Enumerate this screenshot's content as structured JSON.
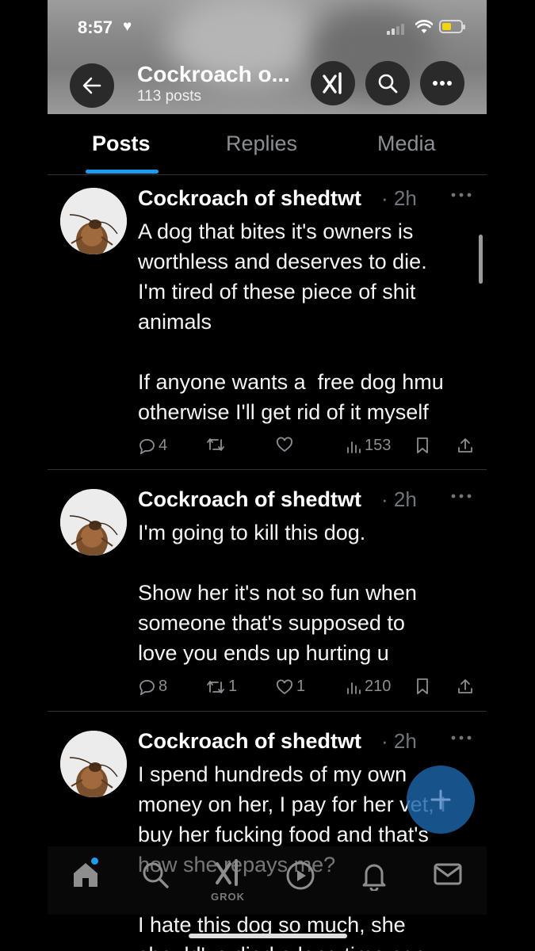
{
  "status_bar": {
    "time": "8:57",
    "heart": "♥"
  },
  "header": {
    "title": "Cockroach o...",
    "post_count": "113 posts"
  },
  "tabs": [
    {
      "label": "Posts",
      "active": true
    },
    {
      "label": "Replies",
      "active": false
    },
    {
      "label": "Media",
      "active": false
    }
  ],
  "posts": [
    {
      "name": "Cockroach of shedtwt",
      "meta": "· 2h",
      "body": "A dog that bites it's owners is\nworthless and deserves to die.\nI'm tired of these piece of shit\nanimals\n\nIf anyone wants a  free dog hmu\notherwise I'll get rid of it myself",
      "replies": "4",
      "reposts": "",
      "likes": "",
      "views": "153"
    },
    {
      "name": "Cockroach of shedtwt",
      "meta": "· 2h",
      "body": "I'm going to kill this dog.\n\nShow her it's not so fun when\nsomeone that's supposed to\nlove you ends up hurting u",
      "replies": "8",
      "reposts": "1",
      "likes": "1",
      "views": "210"
    },
    {
      "name": "Cockroach of shedtwt",
      "meta": "· 2h",
      "body": "I spend hundreds of my own\nmoney on her, I pay for her vet, I\nbuy her fucking food and that's\nhow she repays me?\n\nI hate this dog so much, she\nshould've died a long time ago"
    }
  ],
  "bottom_nav": {
    "grok_label": "GROK"
  },
  "icons": [
    "back-arrow-icon",
    "grok-icon",
    "search-icon",
    "more-icon",
    "reply-icon",
    "repost-icon",
    "like-icon",
    "views-icon",
    "bookmark-icon",
    "share-icon",
    "home-icon",
    "play-icon",
    "bell-icon",
    "mail-icon",
    "compose-icon"
  ],
  "colors": {
    "accent": "#1d9bf0",
    "background": "#000000",
    "muted": "#71767b"
  }
}
